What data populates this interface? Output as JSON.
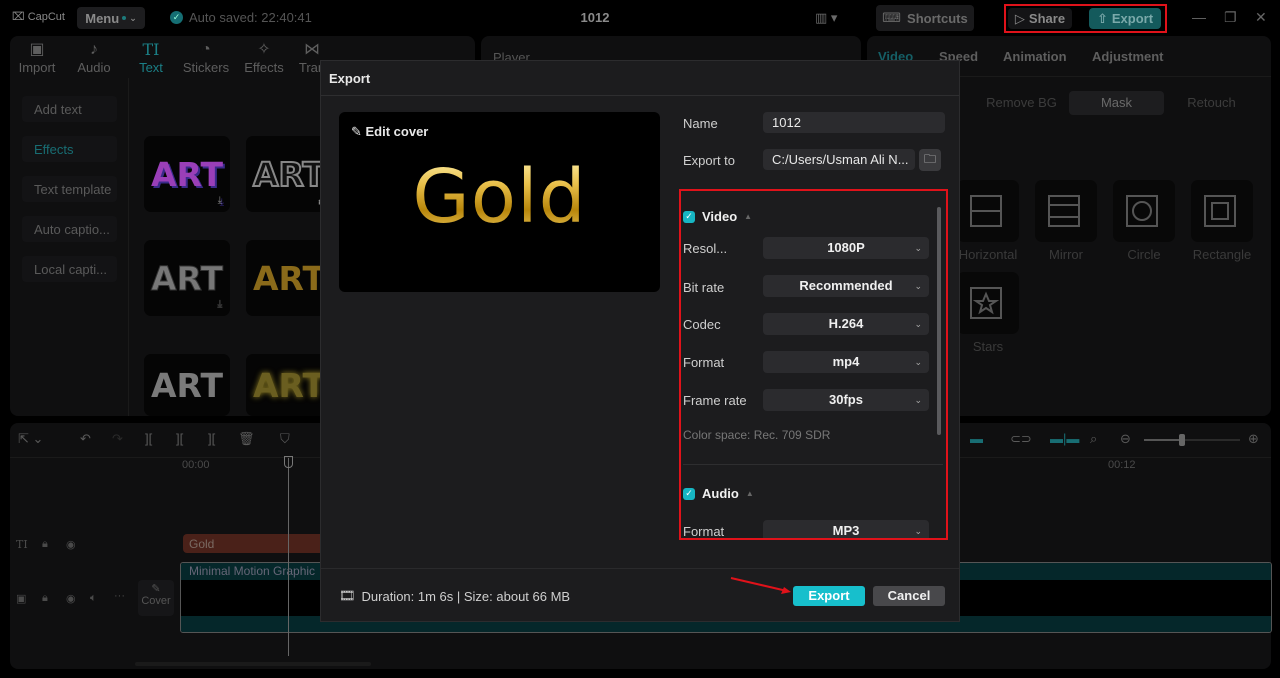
{
  "app": {
    "logo": "CapCut",
    "menu_label": "Menu",
    "autosave": "Auto saved: 22:40:41",
    "project_title": "1012",
    "shortcuts_label": "Shortcuts",
    "share_label": "Share",
    "export_label": "Export"
  },
  "toolbar": {
    "items": [
      {
        "label": "Import",
        "icon": "import-icon"
      },
      {
        "label": "Audio",
        "icon": "audio-icon"
      },
      {
        "label": "Text",
        "icon": "text-icon",
        "active": true
      },
      {
        "label": "Stickers",
        "icon": "stickers-icon"
      },
      {
        "label": "Effects",
        "icon": "effects-icon"
      },
      {
        "label": "Tran",
        "icon": "transitions-icon"
      },
      {
        "label": "",
        "icon": "captions-icon"
      }
    ]
  },
  "text_categories": [
    {
      "label": "Add text"
    },
    {
      "label": "Effects",
      "active": true
    },
    {
      "label": "Text template"
    },
    {
      "label": "Auto captio..."
    },
    {
      "label": "Local capti..."
    }
  ],
  "text_presets": [
    "ART",
    "ART",
    "ART",
    "ART",
    "ART",
    "ART"
  ],
  "player": {
    "title": "Player"
  },
  "inspector": {
    "tabs": [
      "Video",
      "Speed",
      "Animation",
      "Adjustment"
    ],
    "subtabs": [
      "Remove BG",
      "Mask",
      "Retouch"
    ],
    "active_subtab": "Mask",
    "masks": [
      "Horizontal",
      "Mirror",
      "Circle",
      "Rectangle",
      "Stars"
    ]
  },
  "timeline": {
    "time_start": "00:00",
    "time_mark": "00:12",
    "text_clip": "Gold",
    "video_clip": "Minimal Motion Graphic",
    "cover_label": "Cover",
    "zoom_level": 0.4
  },
  "export_dialog": {
    "title": "Export",
    "edit_cover": "Edit cover",
    "cover_text": "Gold",
    "name_label": "Name",
    "name_value": "1012",
    "export_to_label": "Export to",
    "export_to_value": "C:/Users/Usman Ali N...",
    "video_section": {
      "label": "Video",
      "checked": true,
      "settings": [
        {
          "label": "Resol...",
          "value": "1080P"
        },
        {
          "label": "Bit rate",
          "value": "Recommended"
        },
        {
          "label": "Codec",
          "value": "H.264"
        },
        {
          "label": "Format",
          "value": "mp4"
        },
        {
          "label": "Frame rate",
          "value": "30fps"
        }
      ],
      "color_space": "Color space: Rec. 709 SDR"
    },
    "audio_section": {
      "label": "Audio",
      "checked": true,
      "settings": [
        {
          "label": "Format",
          "value": "MP3"
        }
      ]
    },
    "duration_info": "Duration: 1m 6s | Size: about 66 MB",
    "export_button": "Export",
    "cancel_button": "Cancel"
  },
  "colors": {
    "accent": "#17bfcc",
    "highlight_box": "#e0121a"
  }
}
